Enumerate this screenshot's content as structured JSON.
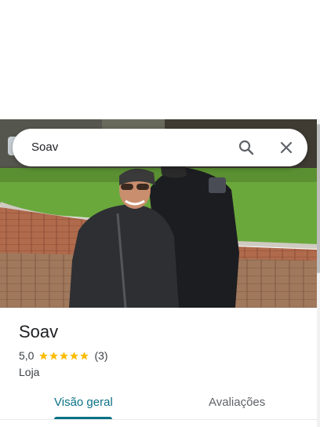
{
  "search": {
    "query": "Soav"
  },
  "icons": {
    "search": "search-icon",
    "close": "close-icon",
    "star": "star-icon"
  },
  "place": {
    "name": "Soav",
    "rating": "5,0",
    "stars": 5,
    "review_count": "(3)",
    "category": "Loja"
  },
  "tabs": [
    {
      "label": "Visão geral",
      "active": true
    },
    {
      "label": "Avaliações",
      "active": false
    }
  ],
  "colors": {
    "accent": "#0b7285",
    "star": "#fbbc04",
    "text": "#202124"
  }
}
